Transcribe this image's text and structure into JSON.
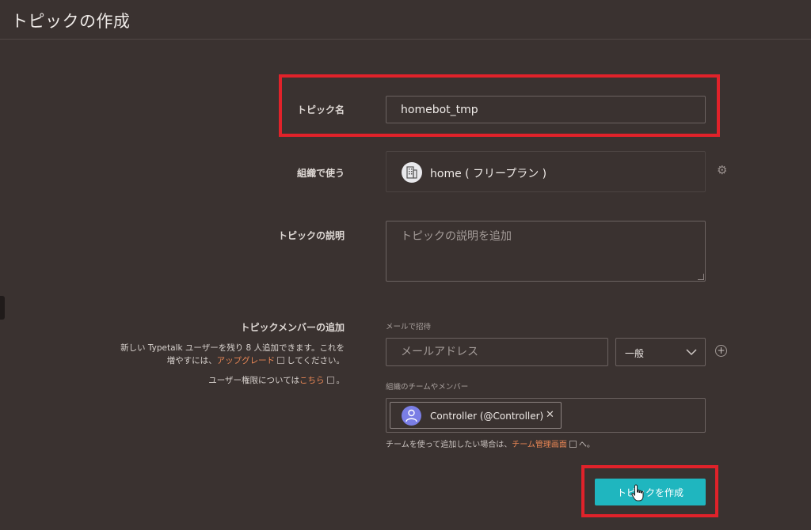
{
  "header": {
    "title": "トピックの作成"
  },
  "form": {
    "topic_name": {
      "label": "トピック名",
      "value": "homebot_tmp"
    },
    "organization": {
      "label": "組織で使う",
      "value": "home ( フリープラン )",
      "icon": "building-icon"
    },
    "description": {
      "label": "トピックの説明",
      "placeholder": "トピックの説明を追加"
    },
    "members": {
      "label": "トピックメンバーの追加",
      "note_line1": "新しい Typetalk ユーザーを残り 8 人追加できます。これを",
      "note_line2_pre": "増やすには、",
      "note_upgrade_link": "アップグレード",
      "note_line2_post": "してください。",
      "permission_pre": "ユーザー権限については",
      "permission_link": "こちら",
      "permission_post": "。",
      "email_caption": "メールで招待",
      "email_placeholder": "メールアドレス",
      "role_value": "一般",
      "team_caption": "組織のチームやメンバー",
      "chip_label": "Controller (@Controller)",
      "team_hint_pre": "チームを使って追加したい場合は、",
      "team_hint_link": "チーム管理画面",
      "team_hint_post": "へ。"
    },
    "submit_label": "トピックを作成"
  },
  "colors": {
    "accent": "#1fb6bf",
    "highlight": "#e0222a",
    "link": "#e88655",
    "background": "#3a3230"
  }
}
